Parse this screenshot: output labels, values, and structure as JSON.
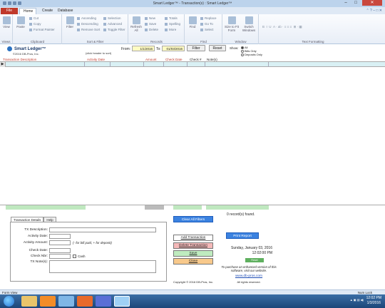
{
  "window": {
    "title": "Smart Ledger™ - Transaction(s) : Smart Ledger™"
  },
  "tabs": {
    "file": "File",
    "home": "Home",
    "create": "Create",
    "database": "Database"
  },
  "ribbon": {
    "views": {
      "view": "View",
      "group": "Views"
    },
    "clipboard": {
      "paste": "Paste",
      "cut": "Cut",
      "copy": "Copy",
      "format_painter": "Format Painter",
      "group": "Clipboard"
    },
    "sort_filter": {
      "filter": "Filter",
      "ascending": "Ascending",
      "descending": "Descending",
      "remove_sort": "Remove Sort",
      "selection": "Selection",
      "advanced": "Advanced",
      "toggle_filter": "Toggle Filter",
      "group": "Sort & Filter"
    },
    "records": {
      "refresh": "Refresh All",
      "new": "New",
      "save": "Save",
      "delete": "Delete",
      "totals": "Totals",
      "spelling": "Spelling",
      "more": "More",
      "group": "Records"
    },
    "find": {
      "find": "Find",
      "replace": "Replace",
      "goto": "Go To",
      "select": "Select",
      "group": "Find"
    },
    "window": {
      "size_to_fit": "Size to Fit Form",
      "switch_windows": "Switch Windows",
      "group": "Window"
    },
    "text_formatting": {
      "group": "Text Formatting"
    }
  },
  "header": {
    "app_name": "Smart Ledger™",
    "copyright": "©2016 DB-Pros, Inc.",
    "click_header_hint": "(click header to sort)",
    "from_label": "From:",
    "from_value": "1/1/2016",
    "to_label": "To:",
    "to_value": "01/03/2016",
    "filter_btn": "Filter",
    "reset_btn": "Reset",
    "show_label": "Show:",
    "radios": [
      "All",
      "Bills Only",
      "Deposits Only"
    ]
  },
  "columns": {
    "transaction_description": "Transaction Description",
    "activity_date": "Activity Date",
    "amount": "Amount",
    "check_date": "Check Date",
    "check_no": "Check #",
    "notes": "Note(s)"
  },
  "detail": {
    "tab_details": "Transaction Details",
    "tab_help": "Help",
    "tx_description": "TX Description:",
    "activity_date": "Activity Date:",
    "activity_amount": "Activity Amount:",
    "amount_note": "(- for bill paid, + for deposit)",
    "check_date": "Check Date:",
    "check_nbr": "Check Nbr:",
    "cash": "Cash",
    "tx_notes": "TX Note(s):"
  },
  "actions": {
    "clear_filters": "Clear All Filters",
    "records_found": "0 record(s) found.",
    "add": "Add Transaction",
    "delete": "Delete Transaction",
    "save": "Save",
    "close": "Close",
    "print_report": "Print Report",
    "date": "Sunday, January 03, 2016",
    "time": "12:02:00 PM",
    "reset_small": "Reset",
    "promo": "To purchase an enhanced version of this software, visit our website.",
    "website": "www.db-pros.com",
    "rights": "All rights reserved.",
    "copyright": "Copyright © 2016 DB-Pros, Inc."
  },
  "status": {
    "left": "Form View",
    "right": "Num Lock"
  },
  "taskbar": {
    "time": "12:02 PM",
    "date": "1/3/2016"
  }
}
